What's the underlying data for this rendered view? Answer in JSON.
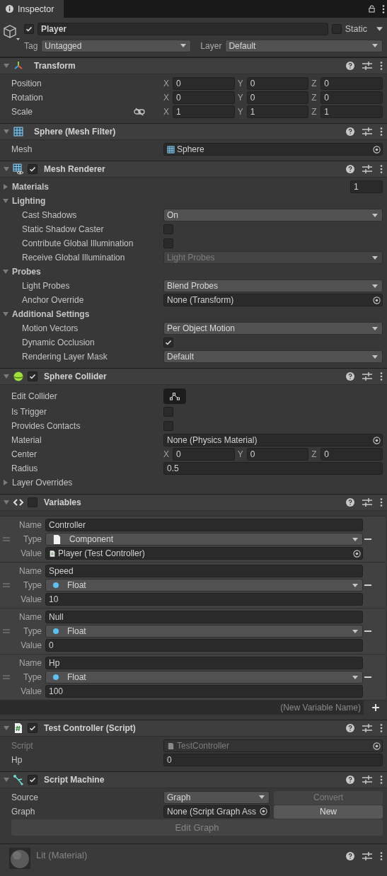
{
  "tab": {
    "label": "Inspector",
    "selected": true
  },
  "object": {
    "active": true,
    "name": "Player",
    "static": false,
    "static_label": "Static",
    "tag_label": "Tag",
    "tag": "Untagged",
    "layer_label": "Layer",
    "layer": "Default"
  },
  "components": [
    {
      "kind": "transform",
      "title": "Transform",
      "expanded": true,
      "rows": [
        {
          "kind": "vector",
          "label": "Position",
          "values": [
            {
              "axis": "X",
              "value": "0"
            },
            {
              "axis": "Y",
              "value": "0"
            },
            {
              "axis": "Z",
              "value": "0"
            }
          ]
        },
        {
          "kind": "vector",
          "label": "Rotation",
          "values": [
            {
              "axis": "X",
              "value": "0"
            },
            {
              "axis": "Y",
              "value": "0"
            },
            {
              "axis": "Z",
              "value": "0"
            }
          ]
        },
        {
          "kind": "vector",
          "label": "Scale",
          "constrained": false,
          "values": [
            {
              "axis": "X",
              "value": "1"
            },
            {
              "axis": "Y",
              "value": "1"
            },
            {
              "axis": "Z",
              "value": "1"
            }
          ]
        }
      ]
    },
    {
      "kind": "mesh_filter",
      "title": "Sphere (Mesh Filter)",
      "expanded": true,
      "rows": [
        {
          "kind": "mesh_ref",
          "label": "Mesh",
          "value": "Sphere",
          "disabled": false
        }
      ]
    },
    {
      "kind": "mesh_renderer",
      "title": "Mesh Renderer",
      "expanded": true,
      "enabled": true,
      "rows": [
        {
          "kind": "group",
          "label": "Materials",
          "expanded": false,
          "value": "1"
        },
        {
          "kind": "group",
          "label": "Lighting",
          "expanded": true,
          "children": [
            {
              "kind": "dropdown",
              "label": "Cast Shadows",
              "value": "On",
              "disabled": false
            },
            {
              "kind": "checkbox",
              "label": "Static Shadow Caster",
              "checked": false
            },
            {
              "kind": "checkbox",
              "label": "Contribute Global Illumination",
              "checked": false
            },
            {
              "kind": "dropdown",
              "label": "Receive Global Illumination",
              "value": "Light Probes",
              "disabled": true
            }
          ]
        },
        {
          "kind": "group",
          "label": "Probes",
          "expanded": true,
          "children": [
            {
              "kind": "dropdown",
              "label": "Light Probes",
              "value": "Blend Probes",
              "disabled": false
            },
            {
              "kind": "object",
              "label": "Anchor Override",
              "value": "None (Transform)",
              "disabled": false
            }
          ]
        },
        {
          "kind": "group",
          "label": "Additional Settings",
          "expanded": true,
          "children": [
            {
              "kind": "dropdown",
              "label": "Motion Vectors",
              "value": "Per Object Motion",
              "disabled": false
            },
            {
              "kind": "checkbox",
              "label": "Dynamic Occlusion",
              "checked": true
            },
            {
              "kind": "dropdown",
              "label": "Rendering Layer Mask",
              "value": "Default",
              "disabled": false
            }
          ]
        }
      ]
    },
    {
      "kind": "collider",
      "title": "Sphere Collider",
      "expanded": true,
      "enabled": true,
      "rows": [
        {
          "kind": "edit",
          "label": "Edit Collider"
        },
        {
          "kind": "checkbox",
          "label": "Is Trigger",
          "checked": false
        },
        {
          "kind": "checkbox",
          "label": "Provides Contacts",
          "checked": false
        },
        {
          "kind": "object",
          "label": "Material",
          "value": "None (Physics Material)",
          "disabled": false
        },
        {
          "kind": "vector",
          "label": "Center",
          "values": [
            {
              "axis": "X",
              "value": "0"
            },
            {
              "axis": "Y",
              "value": "0"
            },
            {
              "axis": "Z",
              "value": "0"
            }
          ]
        },
        {
          "kind": "number",
          "label": "Radius",
          "value": "0.5"
        },
        {
          "kind": "foldout",
          "label": "Layer Overrides",
          "expanded": false
        }
      ]
    },
    {
      "kind": "variables",
      "title": "Variables",
      "expanded": true,
      "enabled": false,
      "variables": [
        {
          "name_label": "Name",
          "name": "Controller",
          "type_label": "Type",
          "type": {
            "kind": "component",
            "text": "Component"
          },
          "value_label": "Value",
          "value": {
            "kind": "object",
            "text": "Player (Test Controller)"
          }
        },
        {
          "name_label": "Name",
          "name": "Speed",
          "type_label": "Type",
          "type": {
            "kind": "float",
            "text": "Float"
          },
          "value_label": "Value",
          "value": {
            "kind": "number",
            "text": "10"
          }
        },
        {
          "name_label": "Name",
          "name": "Null",
          "type_label": "Type",
          "type": {
            "kind": "float",
            "text": "Float"
          },
          "value_label": "Value",
          "value": {
            "kind": "number",
            "text": "0"
          }
        },
        {
          "name_label": "Name",
          "name": "Hp",
          "type_label": "Type",
          "type": {
            "kind": "float",
            "text": "Float"
          },
          "value_label": "Value",
          "value": {
            "kind": "number",
            "text": "100"
          }
        }
      ],
      "new_variable": {
        "placeholder": "(New Variable Name)"
      }
    },
    {
      "kind": "script",
      "title": "Test Controller (Script)",
      "expanded": true,
      "enabled": true,
      "rows": [
        {
          "kind": "script_ref",
          "label": "Script",
          "value": "TestController",
          "disabled": true
        },
        {
          "kind": "number",
          "label": "Hp",
          "value": "0"
        }
      ]
    },
    {
      "kind": "script_machine",
      "title": "Script Machine",
      "expanded": true,
      "enabled": true,
      "rows": [
        {
          "kind": "dropdown_button",
          "label": "Source",
          "value": "Graph",
          "button": "Convert",
          "button_disabled": true
        },
        {
          "kind": "object_button",
          "label": "Graph",
          "value": "None (Script Graph Ass",
          "button": "New",
          "button_disabled": false
        },
        {
          "kind": "wide_button",
          "label": "Edit Graph",
          "disabled": true
        }
      ]
    },
    {
      "kind": "material",
      "title": "Lit (Material)"
    }
  ]
}
